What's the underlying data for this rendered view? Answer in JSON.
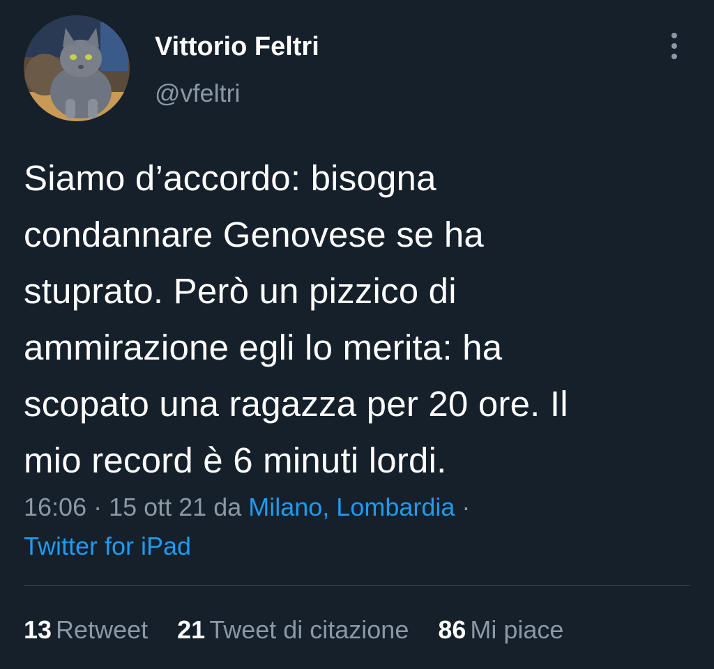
{
  "author": {
    "name": "Vittorio Feltri",
    "handle": "@vfeltri",
    "avatar_icon": "cat-avatar"
  },
  "more_icon": "more-vertical-icon",
  "tweet": {
    "lines": [
      "Siamo d’accordo: bisogna",
      "condannare Genovese se ha",
      "stuprato. Però un pizzico di",
      "ammirazione egli lo merita: ha",
      "scopato una ragazza per 20 ore. Il",
      "mio record è  6 minuti lordi."
    ]
  },
  "meta": {
    "time_date": "16:06 · 15 ott 21 da ",
    "location": "Milano, Lombardia",
    "separator": " ·",
    "source": "Twitter for iPad"
  },
  "stats": [
    {
      "count": "13",
      "label": "Retweet"
    },
    {
      "count": "21",
      "label": "Tweet di citazione"
    },
    {
      "count": "86",
      "label": "Mi piace"
    }
  ],
  "colors": {
    "background": "#15202b",
    "text": "#ffffff",
    "secondary": "#8b98a5",
    "link": "#1d9bf0",
    "divider": "#38444d"
  }
}
